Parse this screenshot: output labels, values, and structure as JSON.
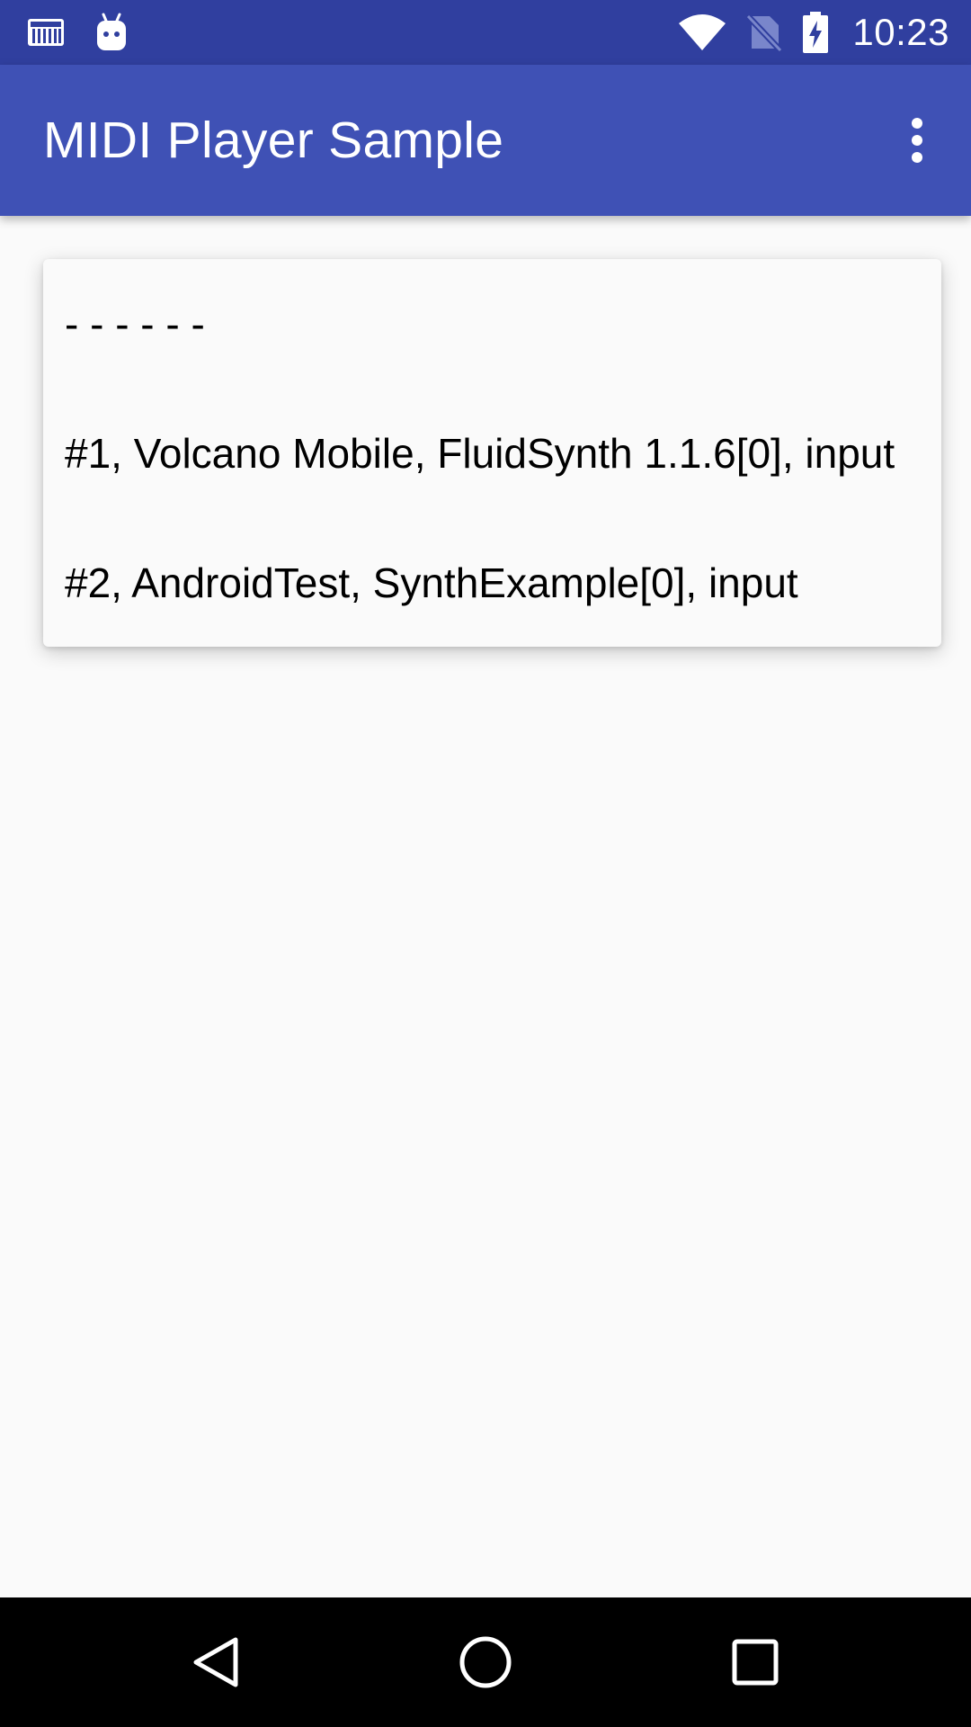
{
  "status_bar": {
    "time": "10:23",
    "left_icons": [
      "piano-keyboard-icon",
      "android-debug-icon"
    ],
    "right_icons": [
      "wifi-icon",
      "no-sim-icon",
      "battery-charging-icon"
    ],
    "background": "#303f9f"
  },
  "app_bar": {
    "title": "MIDI Player Sample",
    "overflow_icon": "more-vert-icon",
    "background": "#3f51b5"
  },
  "device_list": {
    "items": [
      {
        "label": "- - - - - -"
      },
      {
        "label": "#1, Volcano Mobile, FluidSynth 1.1.6[0], input"
      },
      {
        "label": "#2, AndroidTest, SynthExample[0], input"
      }
    ]
  },
  "nav_bar": {
    "back_icon": "back-triangle-icon",
    "home_icon": "home-circle-icon",
    "recents_icon": "recents-square-icon",
    "background": "#000000"
  }
}
